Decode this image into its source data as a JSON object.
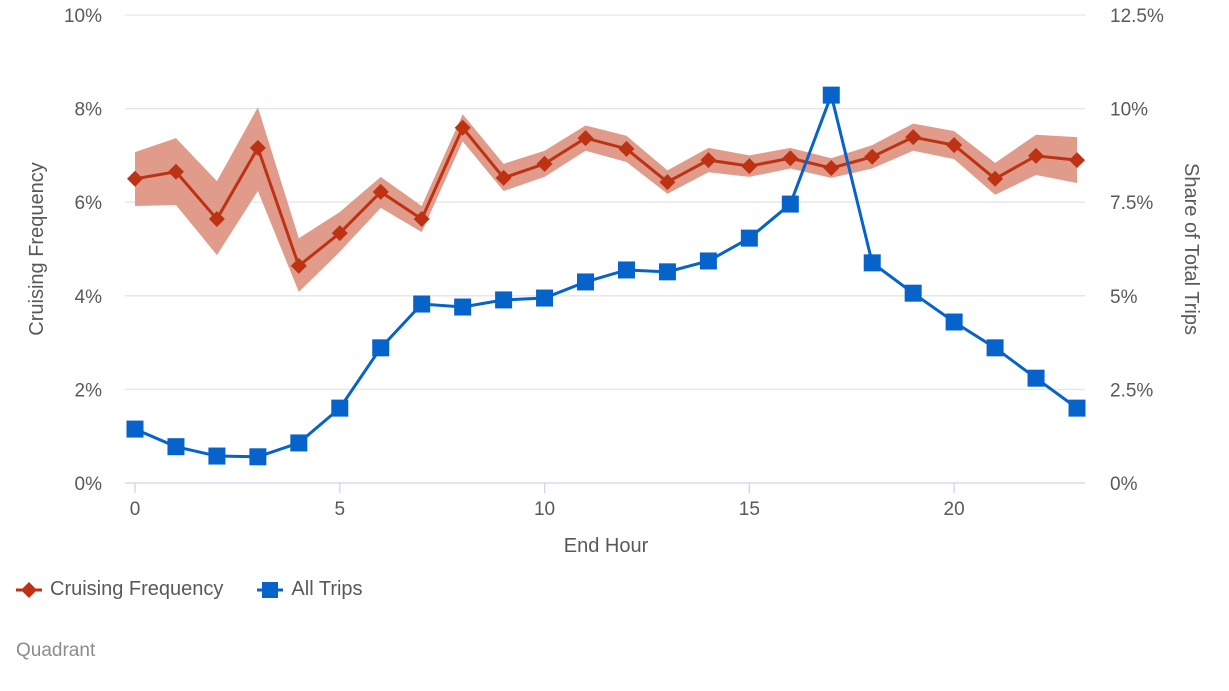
{
  "chart_data": {
    "type": "line",
    "title": "",
    "xlabel": "End Hour",
    "ylabel": "Cruising Frequency",
    "y2label": "Share of Total Trips",
    "x": [
      0,
      1,
      2,
      3,
      4,
      5,
      6,
      7,
      8,
      9,
      10,
      11,
      12,
      13,
      14,
      15,
      16,
      17,
      18,
      19,
      20,
      21,
      22,
      23
    ],
    "x_ticks": [
      0,
      5,
      10,
      15,
      20
    ],
    "x_tick_labels": [
      "0",
      "5",
      "10",
      "15",
      "20"
    ],
    "xlim": [
      -0.25,
      23.2
    ],
    "ylim": [
      0,
      10
    ],
    "y_ticks": [
      0,
      2,
      4,
      6,
      8,
      10
    ],
    "y_tick_labels": [
      "0%",
      "2%",
      "4%",
      "6%",
      "8%",
      "10%"
    ],
    "y2lim": [
      0,
      12.5
    ],
    "y2_ticks": [
      0,
      2.5,
      5,
      7.5,
      10,
      12.5
    ],
    "y2_tick_labels": [
      "0%",
      "2.5%",
      "5%",
      "7.5%",
      "10%",
      "12.5%"
    ],
    "grid": true,
    "legend_position": "bottom-left",
    "series": [
      {
        "name": "Cruising Frequency",
        "axis": "left",
        "marker": "diamond",
        "color": "#BE3214",
        "band_color": "#DE9685",
        "values": [
          6.5,
          6.65,
          5.64,
          7.16,
          4.64,
          5.34,
          6.22,
          5.64,
          7.59,
          6.52,
          6.82,
          7.37,
          7.14,
          6.43,
          6.9,
          6.77,
          6.94,
          6.73,
          6.97,
          7.39,
          7.22,
          6.5,
          6.99,
          6.9
        ],
        "lower": [
          5.92,
          5.94,
          4.87,
          6.24,
          4.08,
          4.94,
          5.88,
          5.36,
          7.3,
          6.24,
          6.54,
          7.1,
          6.86,
          6.18,
          6.64,
          6.54,
          6.72,
          6.52,
          6.72,
          7.1,
          6.92,
          6.16,
          6.58,
          6.41
        ],
        "upper": [
          7.07,
          7.37,
          6.45,
          8.03,
          5.23,
          5.79,
          6.54,
          5.92,
          7.88,
          6.82,
          7.1,
          7.64,
          7.42,
          6.68,
          7.16,
          7.0,
          7.16,
          6.94,
          7.22,
          7.68,
          7.52,
          6.84,
          7.44,
          7.39
        ]
      },
      {
        "name": "All Trips",
        "axis": "right",
        "marker": "square",
        "color": "#0563C9",
        "values": [
          1.44,
          0.97,
          0.72,
          0.7,
          1.07,
          2.0,
          3.61,
          4.78,
          4.7,
          4.89,
          4.94,
          5.37,
          5.69,
          5.64,
          5.93,
          6.54,
          7.45,
          10.36,
          5.88,
          5.07,
          4.3,
          3.61,
          2.8,
          2.0
        ]
      }
    ]
  },
  "legend": {
    "items": [
      {
        "label": "Cruising Frequency",
        "icon": "diamond-marker-icon"
      },
      {
        "label": "All Trips",
        "icon": "square-marker-icon"
      }
    ]
  },
  "credit": "Quadrant",
  "colors": {
    "grid": "#E6E6E6",
    "axis_line": "#CCD6EB",
    "text": "#595959",
    "credit": "#8C8C8C"
  }
}
